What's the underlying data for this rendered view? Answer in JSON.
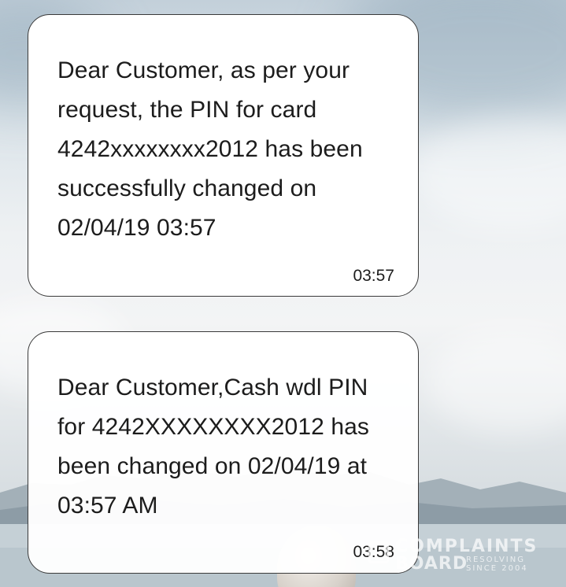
{
  "messages": [
    {
      "text": "Dear Customer, as per your\nrequest, the PIN for card\n4242xxxxxxxx2012 has been\nsuccessfully changed on\n02/04/19 03:57",
      "time": "03:57"
    },
    {
      "text": "Dear Customer,Cash wdl PIN\nfor 4242XXXXXXXX2012 has\nbeen changed on 02/04/19 at\n03:57 AM",
      "time": "03:58"
    }
  ],
  "watermark": {
    "line1": "COMPLAINTS",
    "line2": "BOARD",
    "line3a": "RESOLVING",
    "line3b": "SINCE 2004"
  },
  "colors": {
    "bubble_bg": "#ffffff",
    "bubble_border": "#3a3a3a",
    "text": "#1c1c1c"
  }
}
